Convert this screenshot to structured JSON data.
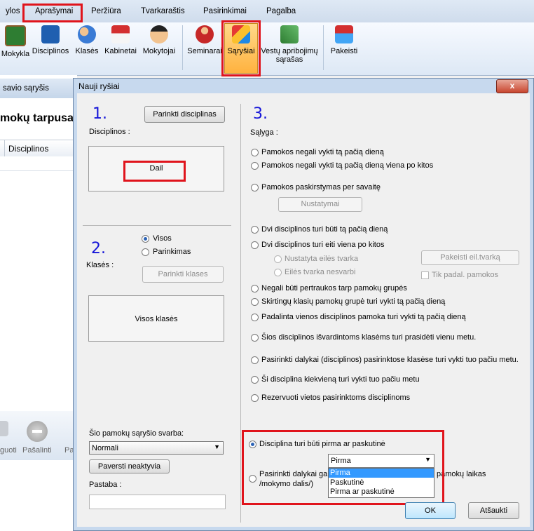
{
  "menubar": {
    "items": [
      "ylos",
      "Aprašymai",
      "Peržiūra",
      "Tvarkaraštis",
      "Pasirinkimai",
      "Pagalba"
    ]
  },
  "ribbon": {
    "buttons": [
      "Mokykla",
      "Disciplinos",
      "Klasės",
      "Kabinetai",
      "Mokytojai",
      "Seminarai",
      "Sąryšiai",
      "Vestų apribojimų sąrašas",
      "Pakeisti"
    ]
  },
  "background": {
    "window_title": "savio sąryšis",
    "heading": "mokų tarpusa",
    "column": "Disciplinos",
    "bottom_buttons": [
      "guoti",
      "Pašalinti",
      "Pa"
    ]
  },
  "dialog": {
    "title": "Nauji ryšiai",
    "close": "x",
    "section1": {
      "number": "1.",
      "choose_button": "Parinkti disciplinas",
      "label": "Disciplinos :",
      "selected": "Dail"
    },
    "section2": {
      "number": "2.",
      "label": "Klasės :",
      "radio_all": "Visos",
      "radio_choose": "Parinkimas",
      "choose_button": "Parinkti klases",
      "box_text": "Visos klasės"
    },
    "section3": {
      "number": "3.",
      "label": "Sąlyga :",
      "options": [
        "Pamokos negali vykti tą pačią dieną",
        "Pamokos negali vykti tą pačią dieną viena po kitos",
        "Pamokos paskirstymas per savaitę",
        "Dvi disciplinos turi būti tą pačią dieną",
        "Dvi disciplinos turi eiti viena po kitos",
        "Negali būti pertraukos tarp pamokų grupės",
        "Skirtingų klasių pamokų grupė turi vykti tą pačią dieną",
        "Padalinta vienos disciplinos pamoka turi vykti tą pačią dieną",
        "Šios disciplinos išvardintoms klasėms turi prasidėti vienu metu.",
        "Pasirinkti dalykai (disciplinos) pasirinktose klasėse turi vykti tuo pačiu metu.",
        "Ši disciplina kiekvieną turi vykti tuo pačiu metu",
        "Rezervuoti vietos pasirinktoms disciplinoms",
        "Disciplina turi būti pirma ar paskutinė",
        "Pasirinkti dalykai gali",
        "pamokų laikas",
        "/mokymo dalis/)"
      ],
      "settings_button": "Nustatymai",
      "sub_radio_1": "Nustatyta eilės tvarka",
      "sub_radio_2": "Eilės tvarka nesvarbi",
      "change_order_button": "Pakeisti eil.tvarką",
      "only_lessons_checkbox": "Tik padal. pamokos",
      "dropdown": {
        "selected": "Pirma",
        "options": [
          "Pirma",
          "Paskutinė",
          "Pirma ar paskutinė"
        ]
      }
    },
    "weight": {
      "label": "Šio pamokų sąryšio svarba:",
      "value": "Normali",
      "inactive_button": "Paversti neaktyvia"
    },
    "note_label": "Pastaba :",
    "ok": "OK",
    "cancel": "Atšaukti"
  },
  "colors": {
    "highlight": "#e0141c",
    "number_blue": "#1515d8",
    "selection_blue": "#3399ff"
  }
}
